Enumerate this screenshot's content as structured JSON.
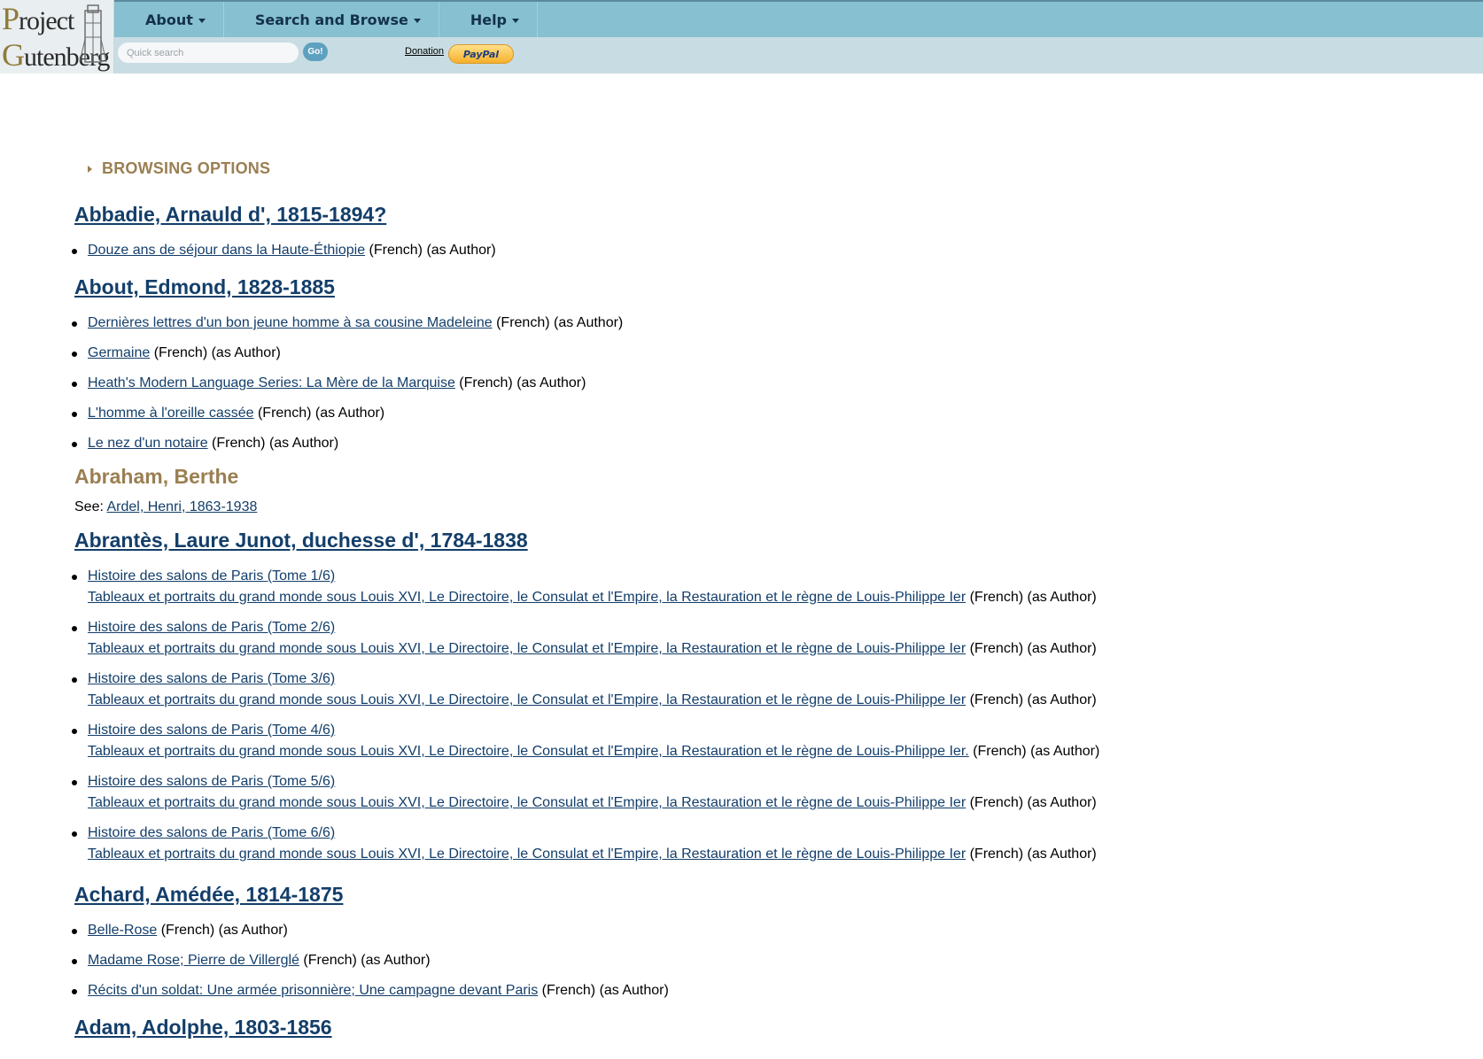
{
  "header": {
    "logo_line1": "Project",
    "logo_line2": "Gutenberg",
    "menu": [
      {
        "label": "About"
      },
      {
        "label": "Search and Browse"
      },
      {
        "label": "Help"
      }
    ],
    "search_placeholder": "Quick search",
    "go_label": "Go!",
    "donation_label": "Donation",
    "paypal_label": "PayPal"
  },
  "browsing_options_label": "BROWSING OPTIONS",
  "authors": [
    {
      "name": "Abbadie, Arnauld d', 1815-1894?",
      "books": [
        {
          "title": "Douze ans de séjour dans la Haute-Éthiopie",
          "meta": " (French) (as Author)"
        }
      ]
    },
    {
      "name": "About, Edmond, 1828-1885",
      "books": [
        {
          "title": "Dernières lettres d'un bon jeune homme à sa cousine Madeleine",
          "meta": " (French) (as Author)"
        },
        {
          "title": "Germaine",
          "meta": " (French) (as Author)"
        },
        {
          "title": "Heath's Modern Language Series: La Mère de la Marquise",
          "meta": " (French) (as Author)"
        },
        {
          "title": "L'homme à l'oreille cassée",
          "meta": " (French) (as Author)"
        },
        {
          "title": "Le nez d'un notaire",
          "meta": " (French) (as Author)"
        }
      ]
    },
    {
      "name": "Abraham, Berthe",
      "see_label": "See: ",
      "see_link": "Ardel, Henri, 1863-1938"
    },
    {
      "name": "Abrantès, Laure Junot, duchesse d', 1784-1838",
      "books": [
        {
          "title": "Histoire des salons de Paris (Tome 1/6) ",
          "subtitle": "Tableaux et portraits du grand monde sous Louis XVI, Le Directoire, le Consulat et l'Empire, la Restauration et le règne de Louis-Philippe Ier",
          "meta": " (French) (as Author)"
        },
        {
          "title": "Histoire des salons de Paris (Tome 2/6) ",
          "subtitle": "Tableaux et portraits du grand monde sous Louis XVI, Le Directoire, le Consulat et l'Empire, la Restauration et le règne de Louis-Philippe Ier",
          "meta": " (French) (as Author)"
        },
        {
          "title": "Histoire des salons de Paris (Tome 3/6) ",
          "subtitle": "Tableaux et portraits du grand monde sous Louis XVI, Le Directoire, le Consulat et l'Empire, la Restauration et le règne de Louis-Philippe Ier",
          "meta": " (French) (as Author)"
        },
        {
          "title": "Histoire des salons de Paris (Tome 4/6) ",
          "subtitle": "Tableaux et portraits du grand monde sous Louis XVI, Le Directoire, le Consulat et l'Empire, la Restauration et le règne de Louis-Philippe Ier.",
          "meta": " (French) (as Author)"
        },
        {
          "title": "Histoire des salons de Paris (Tome 5/6) ",
          "subtitle": "Tableaux et portraits du grand monde sous Louis XVI, Le Directoire, le Consulat et l'Empire, la Restauration et le règne de Louis-Philippe Ier",
          "meta": " (French) (as Author)"
        },
        {
          "title": "Histoire des salons de Paris (Tome 6/6) ",
          "subtitle": "Tableaux et portraits du grand monde sous Louis XVI, Le Directoire, le Consulat et l'Empire, la Restauration et le règne de Louis-Philippe Ier",
          "meta": " (French) (as Author)"
        }
      ]
    },
    {
      "name": "Achard, Amédée, 1814-1875",
      "books": [
        {
          "title": "Belle-Rose",
          "meta": " (French) (as Author)"
        },
        {
          "title": "Madame Rose; Pierre de Villerglé",
          "meta": " (French) (as Author)"
        },
        {
          "title": "Récits d'un soldat: Une armée prisonnière; Une campagne devant Paris",
          "meta": " (French) (as Author)"
        }
      ]
    },
    {
      "name": "Adam, Adolphe, 1803-1856",
      "books": []
    }
  ]
}
